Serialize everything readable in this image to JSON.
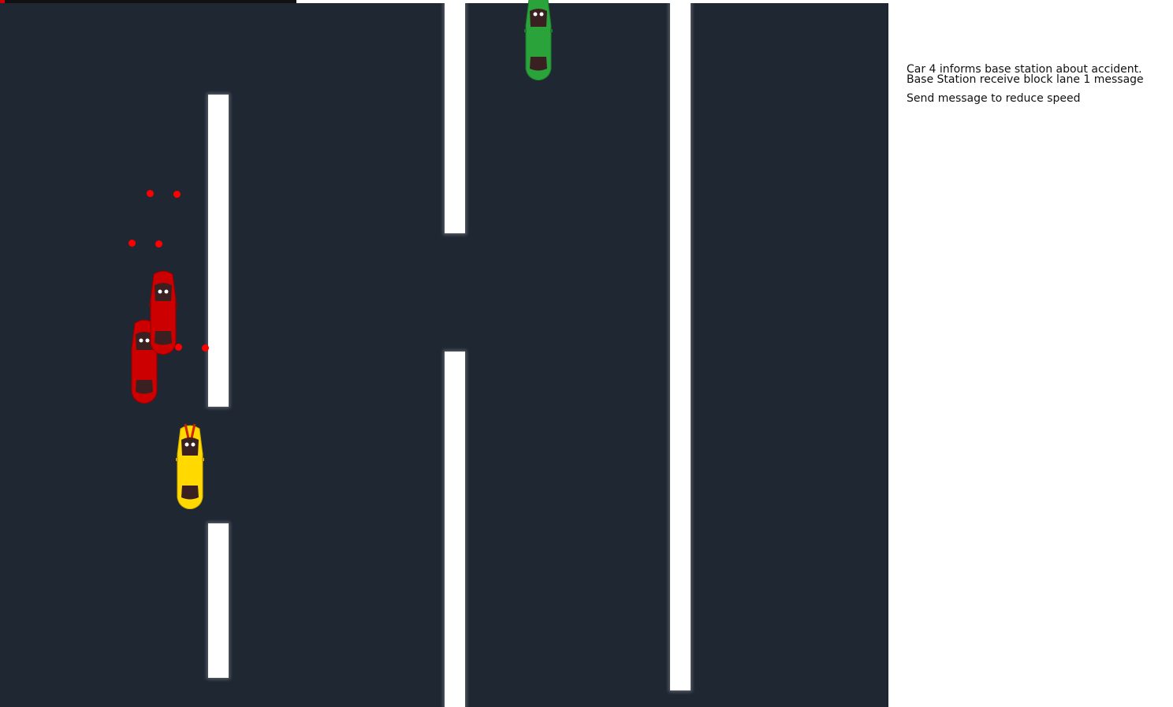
{
  "messages": {
    "line1": "Car 4 informs base station about accident.",
    "line2": "Base Station receive block lane 1 message",
    "line3": "Send message to reduce speed"
  },
  "colors": {
    "road": "#1f2733",
    "lane_marking": "#ffffff",
    "car_red": "#cc0000",
    "car_yellow": "#ffd900",
    "car_green": "#2aa43a",
    "signal_dot": "#ff0000"
  },
  "cars": [
    {
      "name": "car-green",
      "color": "green"
    },
    {
      "name": "car-red-front",
      "color": "red"
    },
    {
      "name": "car-red-back",
      "color": "red"
    },
    {
      "name": "car-yellow",
      "color": "yellow"
    }
  ]
}
